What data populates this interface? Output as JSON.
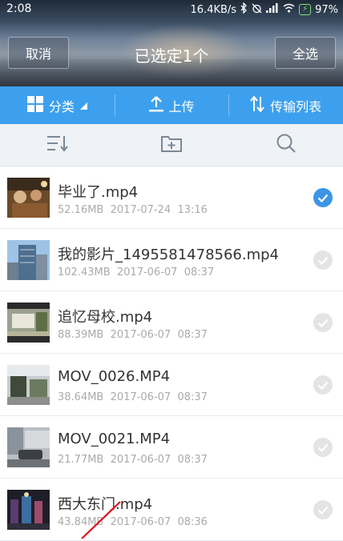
{
  "status_bar": {
    "time": "2:08",
    "network_speed": "16.4KB/s",
    "battery": "97%"
  },
  "header": {
    "cancel_label": "取消",
    "title": "已选定1个",
    "select_all_label": "全选"
  },
  "tabs": [
    {
      "label": "分类",
      "icon": "grid-icon"
    },
    {
      "label": "上传",
      "icon": "upload-icon"
    },
    {
      "label": "传输列表",
      "icon": "transfer-icon"
    }
  ],
  "toolbar": [
    {
      "icon": "sort-icon"
    },
    {
      "icon": "new-folder-icon"
    },
    {
      "icon": "search-icon"
    }
  ],
  "files": [
    {
      "name": "毕业了.mp4",
      "size": "52.16MB",
      "date": "2017-07-24",
      "time": "13:16",
      "selected": true
    },
    {
      "name": "我的影片_1495581478566.mp4",
      "size": "102.43MB",
      "date": "2017-06-07",
      "time": "08:37",
      "selected": false
    },
    {
      "name": "追忆母校.mp4",
      "size": "88.39MB",
      "date": "2017-06-07",
      "time": "08:37",
      "selected": false
    },
    {
      "name": "MOV_0026.MP4",
      "size": "38.64MB",
      "date": "2017-06-07",
      "time": "08:37",
      "selected": false
    },
    {
      "name": "MOV_0021.MP4",
      "size": "21.77MB",
      "date": "2017-06-07",
      "time": "08:37",
      "selected": false
    },
    {
      "name": "西大东门.mp4",
      "size": "43.84MB",
      "date": "2017-06-07",
      "time": "08:36",
      "selected": false
    }
  ],
  "colors": {
    "accent": "#3da0ee",
    "check_on": "#3d94e6",
    "check_off": "#e4e4e4",
    "annotation": "#e0141e"
  }
}
